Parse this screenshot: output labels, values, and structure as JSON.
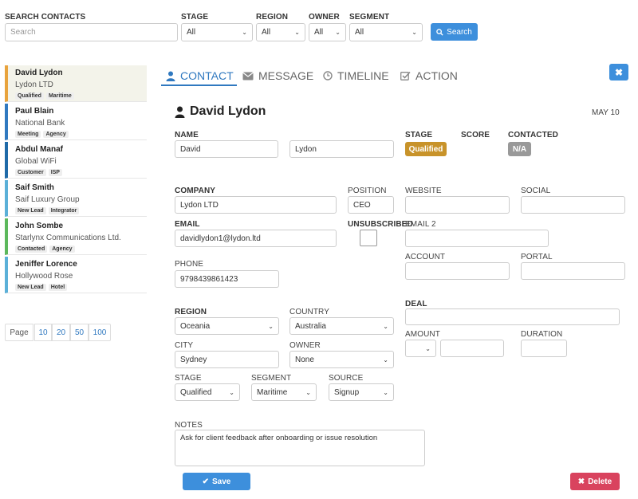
{
  "search": {
    "label": "SEARCH CONTACTS",
    "placeholder": "Search",
    "stage_label": "STAGE",
    "stage_value": "All",
    "region_label": "REGION",
    "region_value": "All",
    "owner_label": "OWNER",
    "owner_value": "All",
    "segment_label": "SEGMENT",
    "segment_value": "All",
    "button": "Search"
  },
  "contacts": [
    {
      "name": "David Lydon",
      "company": "Lydon LTD",
      "tags": [
        "Qualified",
        "Maritime"
      ],
      "color": "#e8a33d"
    },
    {
      "name": "Paul Blain",
      "company": "National Bank",
      "tags": [
        "Meeting",
        "Agency"
      ],
      "color": "#3079c0"
    },
    {
      "name": "Abdul Manaf",
      "company": "Global WiFi",
      "tags": [
        "Customer",
        "ISP"
      ],
      "color": "#1f6aa8"
    },
    {
      "name": "Saif Smith",
      "company": "Saif Luxury Group",
      "tags": [
        "New Lead",
        "Integrator"
      ],
      "color": "#5bb0d8"
    },
    {
      "name": "John Sombe",
      "company": "Starlynx Communications Ltd.",
      "tags": [
        "Contacted",
        "Agency"
      ],
      "color": "#5cb85c"
    },
    {
      "name": "Jeniffer Lorence",
      "company": "Hollywood Rose",
      "tags": [
        "New Lead",
        "Hotel"
      ],
      "color": "#5bb0d8"
    }
  ],
  "pagination": {
    "label": "Page",
    "options": [
      "10",
      "20",
      "50",
      "100"
    ]
  },
  "tabs": {
    "contact": "CONTACT",
    "message": "MESSAGE",
    "timeline": "TIMELINE",
    "action": "ACTION"
  },
  "detail": {
    "name": "David Lydon",
    "date": "MAY 10",
    "name_label": "NAME",
    "first": "David",
    "last": "Lydon",
    "stage_label": "STAGE",
    "stage_badge": "Qualified",
    "score_label": "SCORE",
    "contacted_label": "CONTACTED",
    "contacted_badge": "N/A",
    "company_label": "COMPANY",
    "company": "Lydon LTD",
    "position_label": "POSITION",
    "position": "CEO",
    "website_label": "WEBSITE",
    "social_label": "SOCIAL",
    "email_label": "EMAIL",
    "email": "davidlydon1@lydon.ltd",
    "unsub_label": "UNSUBSCRIBED",
    "email2_label": "EMAIL 2",
    "account_label": "ACCOUNT",
    "portal_label": "PORTAL",
    "phone_label": "PHONE",
    "phone": "9798439861423",
    "region_label": "REGION",
    "region": "Oceania",
    "country_label": "COUNTRY",
    "country": "Australia",
    "deal_label": "DEAL",
    "city_label": "CITY",
    "city": "Sydney",
    "owner_label": "OWNER",
    "owner": "None",
    "amount_label": "AMOUNT",
    "duration_label": "DURATION",
    "stage2_label": "STAGE",
    "stage2": "Qualified",
    "segment_label": "SEGMENT",
    "segment": "Maritime",
    "source_label": "SOURCE",
    "source": "Signup",
    "notes_label": "NOTES",
    "notes": "Ask for client feedback after onboarding or issue resolution",
    "save": "Save",
    "delete": "Delete"
  },
  "colors": {
    "accent": "#3d8fdc",
    "qualified": "#c8932a",
    "na": "#999999",
    "delete": "#d9435e"
  }
}
